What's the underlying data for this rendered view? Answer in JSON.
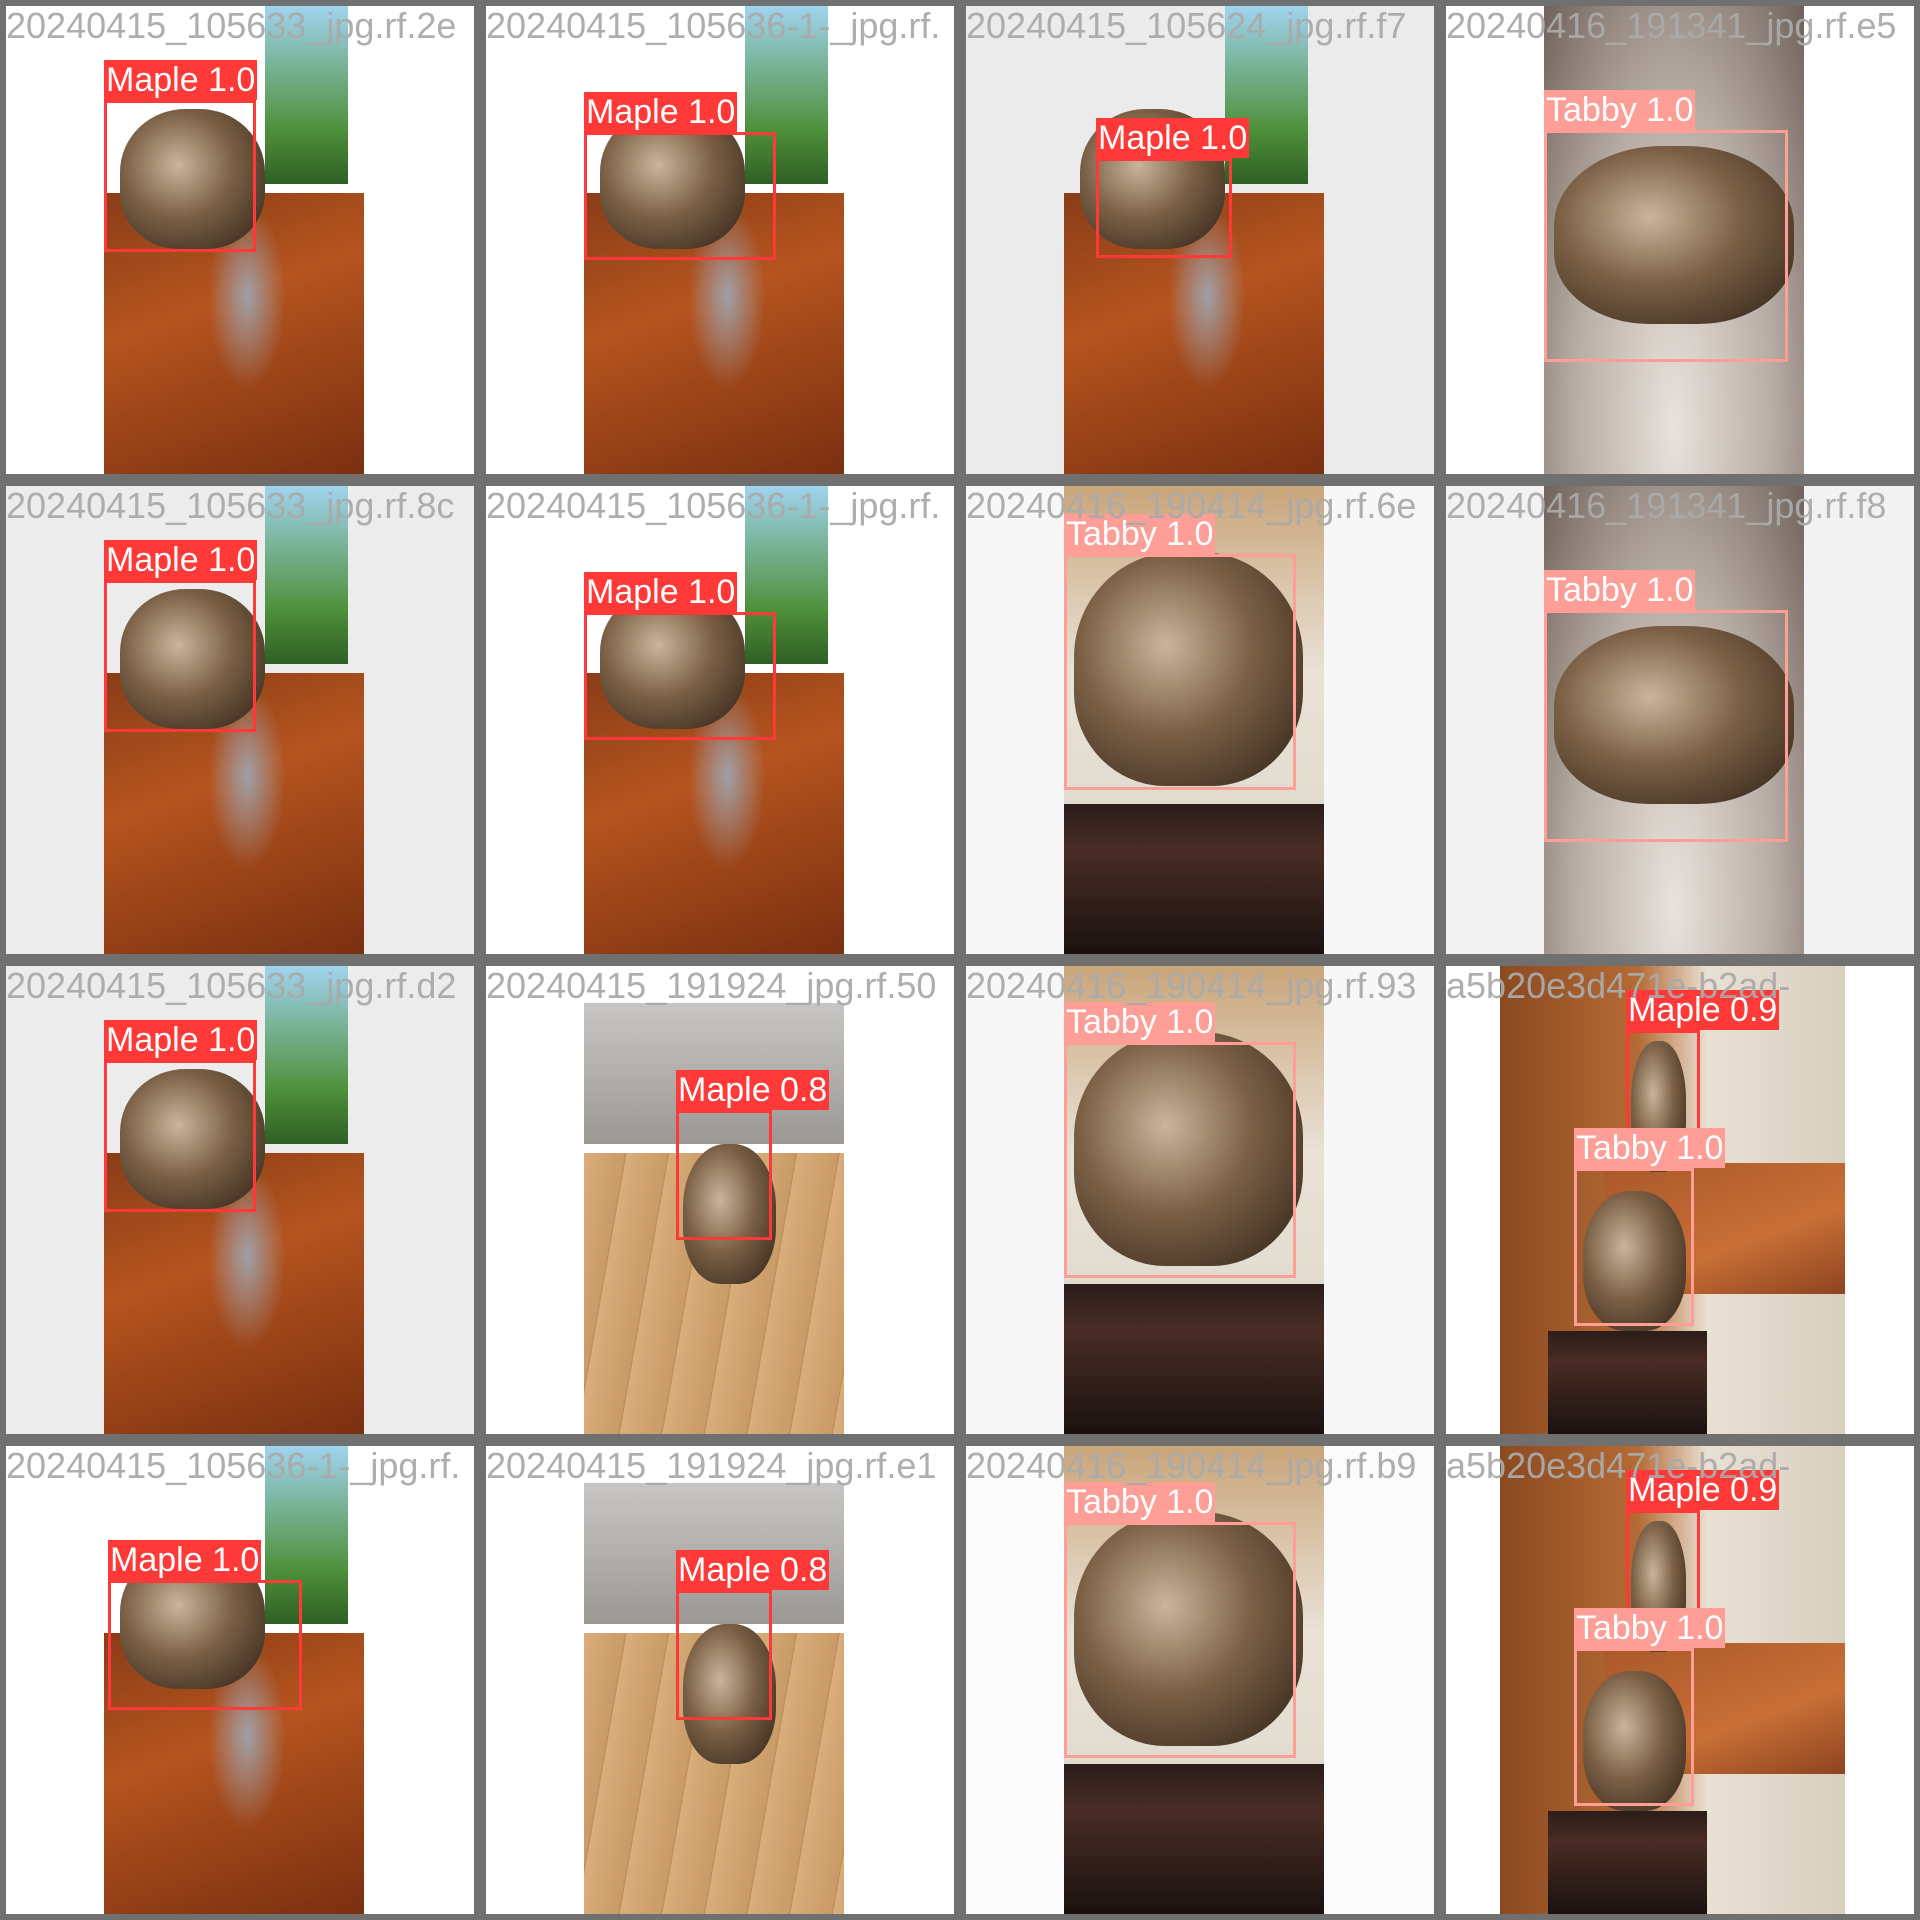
{
  "colors": {
    "maple": "#ff3838",
    "tabby": "#ff9d97",
    "tile_border": "#707070",
    "filename_text": "#aaaaaa"
  },
  "tiles": [
    {
      "filename": "20240415_105633_jpg.rf.2e",
      "scene": "hall",
      "bg": "#ffffff",
      "detections": [
        {
          "label": "Maple 1.0",
          "cls": "maple"
        }
      ]
    },
    {
      "filename": "20240415_105636-1-_jpg.rf.",
      "scene": "hall",
      "bg": "#ffffff",
      "detections": [
        {
          "label": "Maple 1.0",
          "cls": "maple"
        }
      ]
    },
    {
      "filename": "20240415_105624_jpg.rf.f7",
      "scene": "hall",
      "bg": "#ebebeb",
      "detections": [
        {
          "label": "Maple 1.0",
          "cls": "maple"
        }
      ]
    },
    {
      "filename": "20240416_191341_jpg.rf.e5",
      "scene": "fur",
      "bg": "#ffffff",
      "detections": [
        {
          "label": "Tabby 1.0",
          "cls": "tabby"
        }
      ]
    },
    {
      "filename": "20240415_105633_jpg.rf.8c",
      "scene": "hall",
      "bg": "#ececec",
      "detections": [
        {
          "label": "Maple 1.0",
          "cls": "maple"
        }
      ]
    },
    {
      "filename": "20240415_105636-1-_jpg.rf.",
      "scene": "hall",
      "bg": "#ffffff",
      "detections": [
        {
          "label": "Maple 1.0",
          "cls": "maple"
        }
      ]
    },
    {
      "filename": "20240416_190414_jpg.rf.6e",
      "scene": "stool",
      "bg": "#f7f7f7",
      "detections": [
        {
          "label": "Tabby 1.0",
          "cls": "tabby"
        }
      ]
    },
    {
      "filename": "20240416_191341_jpg.rf.f8",
      "scene": "fur",
      "bg": "#f2f2f2",
      "detections": [
        {
          "label": "Tabby 1.0",
          "cls": "tabby"
        }
      ]
    },
    {
      "filename": "20240415_105633_jpg.rf.d2",
      "scene": "hall",
      "bg": "#ececec",
      "detections": [
        {
          "label": "Maple 1.0",
          "cls": "maple"
        }
      ]
    },
    {
      "filename": "20240415_191924_jpg.rf.50",
      "scene": "lounge",
      "bg": "#ffffff",
      "detections": [
        {
          "label": "Maple 0.8",
          "cls": "maple"
        }
      ]
    },
    {
      "filename": "20240416_190414_jpg.rf.93",
      "scene": "stool",
      "bg": "#f7f7f7",
      "detections": [
        {
          "label": "Tabby 1.0",
          "cls": "tabby"
        }
      ]
    },
    {
      "filename": "a5b20e3d471e-b2ad-",
      "scene": "kitchen",
      "bg": "#ffffff",
      "detections": [
        {
          "label": "Maple 0.9",
          "cls": "maple"
        },
        {
          "label": "Tabby 1.0",
          "cls": "tabby"
        }
      ]
    },
    {
      "filename": "20240415_105636-1-_jpg.rf.",
      "scene": "hall",
      "bg": "#ffffff",
      "detections": [
        {
          "label": "Maple 1.0",
          "cls": "maple"
        }
      ]
    },
    {
      "filename": "20240415_191924_jpg.rf.e1",
      "scene": "lounge",
      "bg": "#ffffff",
      "detections": [
        {
          "label": "Maple 0.8",
          "cls": "maple"
        }
      ]
    },
    {
      "filename": "20240416_190414_jpg.rf.b9",
      "scene": "stool",
      "bg": "#fbfbfb",
      "detections": [
        {
          "label": "Tabby 1.0",
          "cls": "tabby"
        }
      ]
    },
    {
      "filename": "a5b20e3d471e-b2ad-",
      "scene": "kitchen",
      "bg": "#ffffff",
      "detections": [
        {
          "label": "Maple 0.9",
          "cls": "maple"
        },
        {
          "label": "Tabby 1.0",
          "cls": "tabby"
        }
      ]
    }
  ]
}
